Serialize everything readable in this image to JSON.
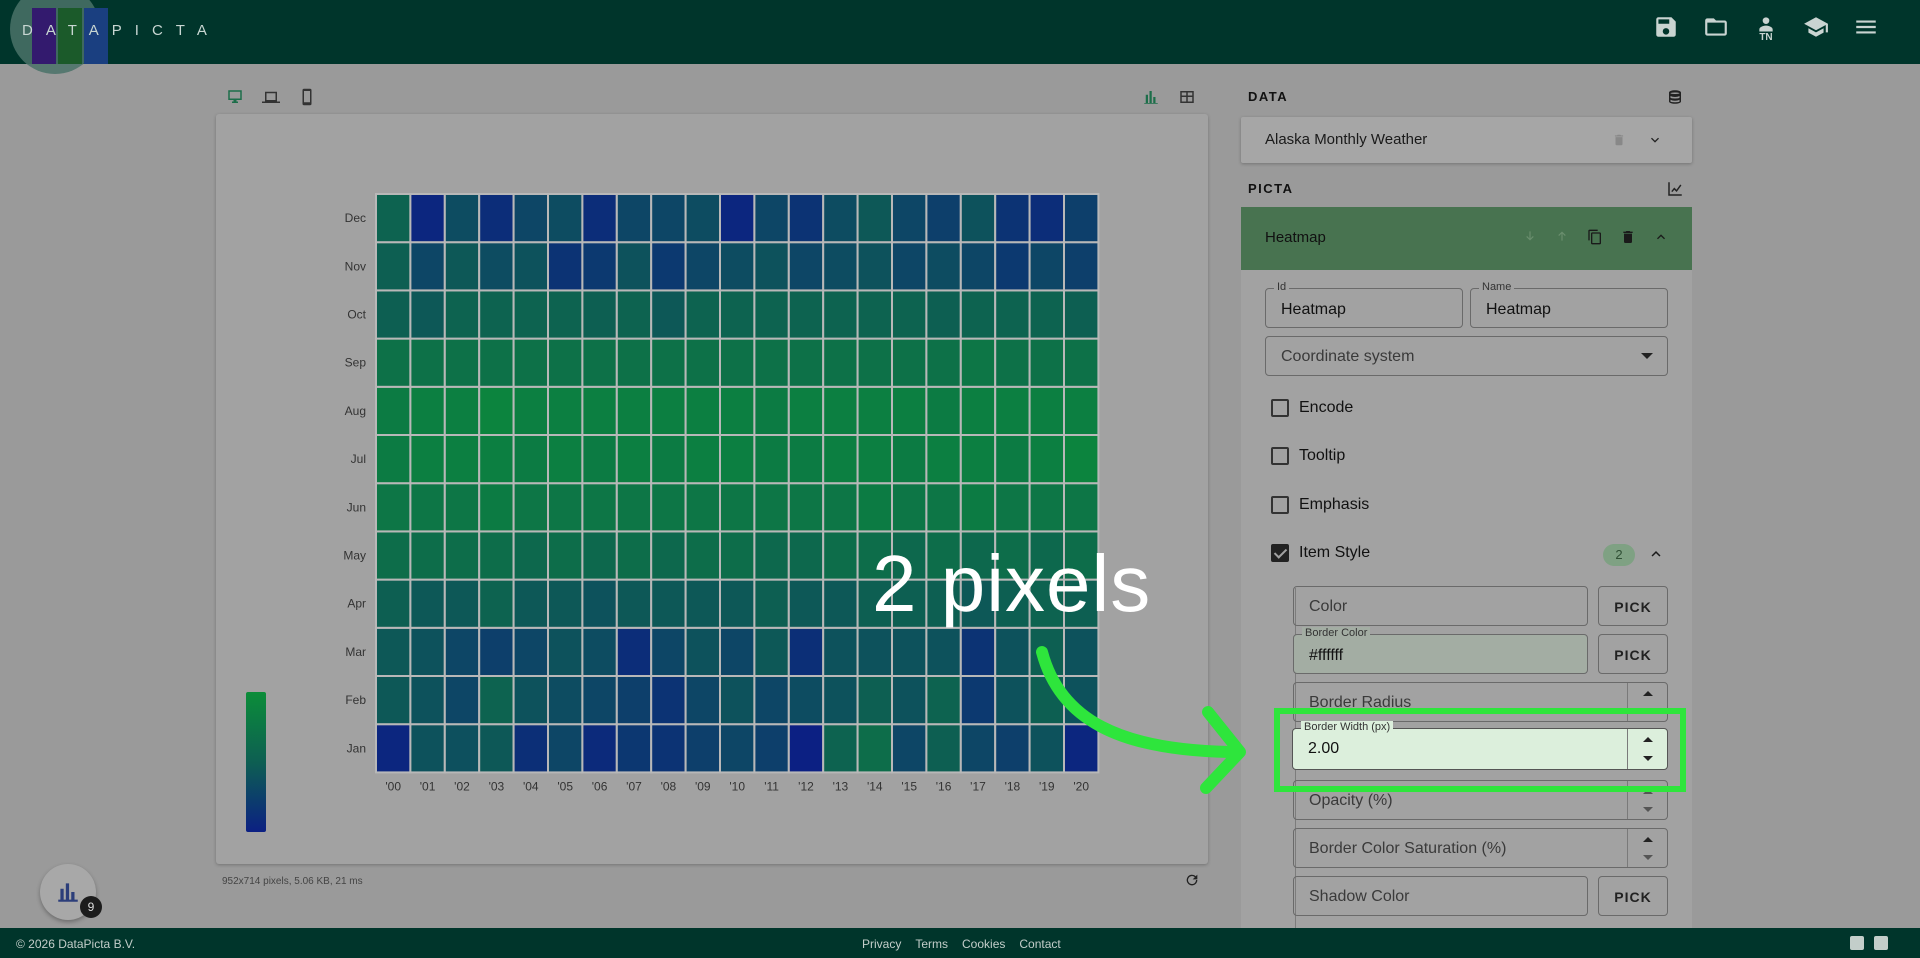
{
  "app": {
    "logo_text": "DATAPICTA",
    "user_initials": "TN"
  },
  "canvas": {
    "info": "952x714 pixels, 5.06 KB, 21 ms"
  },
  "data_section": {
    "label": "DATA",
    "dataset_title": "Alaska Monthly Weather"
  },
  "picta_section": {
    "label": "PICTA",
    "component_title": "Heatmap",
    "id_label": "Id",
    "id_value": "Heatmap",
    "name_label": "Name",
    "name_value": "Heatmap",
    "coordinate_placeholder": "Coordinate system",
    "options": [
      {
        "label": "Encode",
        "checked": false
      },
      {
        "label": "Tooltip",
        "checked": false
      },
      {
        "label": "Emphasis",
        "checked": false
      },
      {
        "label": "Item Style",
        "checked": true
      }
    ],
    "item_style_count": "2",
    "item_style": {
      "color_placeholder": "Color",
      "pick_label": "PICK",
      "border_color_label": "Border Color",
      "border_color_value": "#ffffff",
      "border_radius_placeholder": "Border Radius",
      "border_width_label": "Border Width (px)",
      "border_width_value": "2.00",
      "opacity_placeholder": "Opacity (%)",
      "border_color_saturation_placeholder": "Border Color Saturation (%)",
      "shadow_color_placeholder": "Shadow Color"
    }
  },
  "annotation": {
    "text": "2 pixels",
    "color": "#2ee53c"
  },
  "fab_badge": "9",
  "footer": {
    "copyright": "© 2026 DataPicta B.V.",
    "links": [
      "Privacy",
      "Terms",
      "Cookies",
      "Contact"
    ]
  },
  "chart_data": {
    "type": "heatmap",
    "x_categories": [
      "'00",
      "'01",
      "'02",
      "'03",
      "'04",
      "'05",
      "'06",
      "'07",
      "'08",
      "'09",
      "'10",
      "'11",
      "'12",
      "'13",
      "'14",
      "'15",
      "'16",
      "'17",
      "'18",
      "'19",
      "'20"
    ],
    "y_categories": [
      "Jan",
      "Feb",
      "Mar",
      "Apr",
      "May",
      "Jun",
      "Jul",
      "Aug",
      "Sep",
      "Oct",
      "Nov",
      "Dec"
    ],
    "values": [
      [
        0.05,
        0.4,
        0.38,
        0.45,
        0.12,
        0.3,
        0.08,
        0.18,
        0.15,
        0.25,
        0.3,
        0.25,
        0.0,
        0.55,
        0.65,
        0.3,
        0.5,
        0.3,
        0.25,
        0.4,
        0.05
      ],
      [
        0.45,
        0.4,
        0.3,
        0.55,
        0.4,
        0.35,
        0.3,
        0.25,
        0.15,
        0.3,
        0.4,
        0.3,
        0.35,
        0.4,
        0.5,
        0.4,
        0.55,
        0.2,
        0.4,
        0.5,
        0.4
      ],
      [
        0.45,
        0.4,
        0.3,
        0.25,
        0.3,
        0.4,
        0.35,
        0.1,
        0.3,
        0.4,
        0.3,
        0.45,
        0.12,
        0.4,
        0.4,
        0.4,
        0.4,
        0.15,
        0.4,
        0.5,
        0.4
      ],
      [
        0.5,
        0.45,
        0.45,
        0.55,
        0.45,
        0.45,
        0.4,
        0.45,
        0.45,
        0.45,
        0.45,
        0.5,
        0.45,
        0.45,
        0.5,
        0.5,
        0.5,
        0.45,
        0.5,
        0.55,
        0.5
      ],
      [
        0.65,
        0.65,
        0.65,
        0.65,
        0.6,
        0.65,
        0.6,
        0.65,
        0.6,
        0.65,
        0.65,
        0.6,
        0.6,
        0.65,
        0.65,
        0.6,
        0.65,
        0.6,
        0.65,
        0.6,
        0.65
      ],
      [
        0.75,
        0.75,
        0.75,
        0.8,
        0.75,
        0.75,
        0.75,
        0.75,
        0.75,
        0.75,
        0.75,
        0.75,
        0.75,
        0.75,
        0.8,
        0.75,
        0.75,
        0.8,
        0.75,
        0.75,
        0.75
      ],
      [
        0.8,
        0.85,
        0.85,
        0.85,
        0.8,
        0.85,
        0.8,
        0.85,
        0.8,
        0.85,
        0.85,
        0.8,
        0.8,
        0.85,
        0.85,
        0.8,
        0.85,
        0.85,
        0.8,
        0.85,
        0.9
      ],
      [
        0.8,
        0.85,
        0.85,
        0.9,
        0.85,
        0.85,
        0.85,
        0.85,
        0.85,
        0.85,
        0.85,
        0.8,
        0.85,
        0.85,
        0.85,
        0.85,
        0.8,
        0.85,
        0.85,
        0.85,
        0.85
      ],
      [
        0.7,
        0.7,
        0.7,
        0.7,
        0.7,
        0.7,
        0.7,
        0.7,
        0.7,
        0.7,
        0.7,
        0.7,
        0.7,
        0.7,
        0.7,
        0.7,
        0.7,
        0.75,
        0.7,
        0.7,
        0.7
      ],
      [
        0.5,
        0.45,
        0.55,
        0.55,
        0.55,
        0.55,
        0.5,
        0.55,
        0.45,
        0.55,
        0.55,
        0.55,
        0.55,
        0.55,
        0.55,
        0.55,
        0.5,
        0.55,
        0.55,
        0.55,
        0.5
      ],
      [
        0.5,
        0.3,
        0.45,
        0.35,
        0.4,
        0.15,
        0.2,
        0.4,
        0.2,
        0.3,
        0.35,
        0.4,
        0.3,
        0.35,
        0.4,
        0.3,
        0.35,
        0.3,
        0.2,
        0.3,
        0.25
      ],
      [
        0.55,
        0.05,
        0.35,
        0.1,
        0.3,
        0.35,
        0.1,
        0.3,
        0.3,
        0.35,
        0.05,
        0.3,
        0.15,
        0.35,
        0.45,
        0.3,
        0.25,
        0.4,
        0.15,
        0.1,
        0.25
      ]
    ],
    "visual_map_colors": [
      "#001a99",
      "#016a5a",
      "#00a63a"
    ],
    "cell_border_color": "#ffffff"
  }
}
